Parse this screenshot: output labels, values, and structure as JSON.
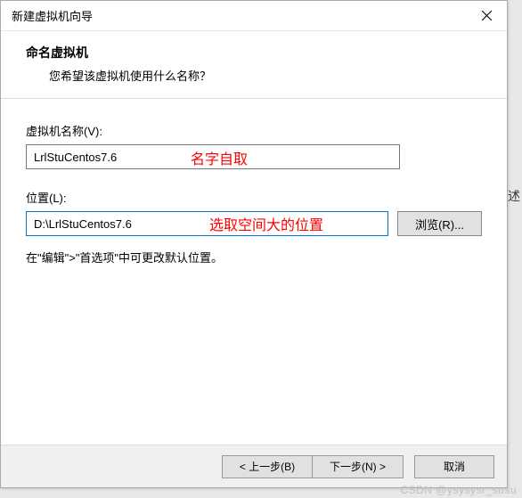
{
  "window": {
    "title": "新建虚拟机向导",
    "close_icon": "×"
  },
  "header": {
    "title": "命名虚拟机",
    "subtitle": "您希望该虚拟机使用什么名称？"
  },
  "fields": {
    "name_label": "虚拟机名称(V):",
    "name_value": "LrlStuCentos7.6",
    "location_label": "位置(L):",
    "location_value": "D:\\LrlStuCentos7.6",
    "browse_label": "浏览(R)..."
  },
  "hint": "在\"编辑\">\"首选项\"中可更改默认位置。",
  "annotations": {
    "name_note": "名字自取",
    "location_note": "选取空间大的位置"
  },
  "footer": {
    "back": "< 上一步(B)",
    "next": "下一步(N) >",
    "cancel": "取消"
  },
  "outside": {
    "fragment": "述"
  },
  "watermark": "CSDN @ysysysr_susu"
}
